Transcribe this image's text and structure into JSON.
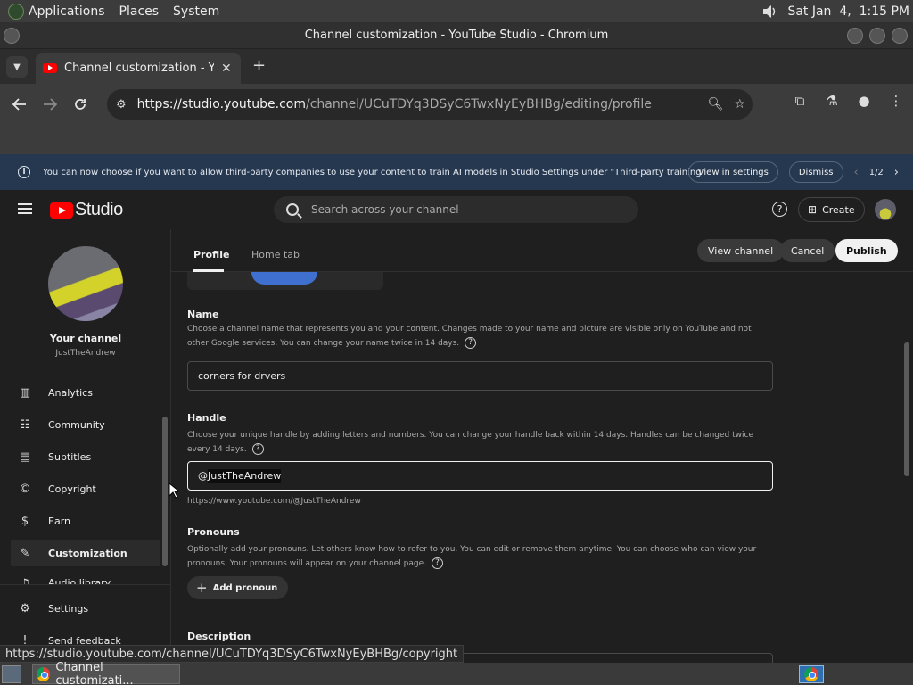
{
  "system_panel": {
    "menus": [
      "Applications",
      "Places",
      "System"
    ],
    "clock": "Sat Jan  4,  1:15 PM"
  },
  "window": {
    "title": "Channel customization - YouTube Studio - Chromium"
  },
  "browser": {
    "tab": {
      "title": "Channel customization - YouTube Studio",
      "close": "✕"
    },
    "new_tab": "+",
    "url_host": "https://studio.youtube.com",
    "url_path": "/channel/UCuTDYq3DSyC6TwxNyEyBHBg/editing/profile"
  },
  "banner": {
    "text": "You can now choose if you want to allow third-party companies to use your content to train AI models in Studio Settings under \"Third-party training\"",
    "view_settings": "View in settings",
    "dismiss": "Dismiss",
    "pager": "1/2"
  },
  "studio": {
    "logo_text": "Studio",
    "search_placeholder": "Search across your channel",
    "create_label": "Create"
  },
  "sidebar": {
    "channel_title": "Your channel",
    "channel_handle": "JustTheAndrew",
    "items": [
      {
        "label": "Analytics",
        "icon": "analytics-icon"
      },
      {
        "label": "Community",
        "icon": "community-icon"
      },
      {
        "label": "Subtitles",
        "icon": "subtitles-icon"
      },
      {
        "label": "Copyright",
        "icon": "copyright-icon"
      },
      {
        "label": "Earn",
        "icon": "earn-icon"
      },
      {
        "label": "Customization",
        "icon": "customization-icon"
      },
      {
        "label": "Audio library",
        "icon": "audio-library-icon"
      },
      {
        "label": "Settings",
        "icon": "settings-icon"
      },
      {
        "label": "Send feedback",
        "icon": "feedback-icon"
      }
    ]
  },
  "main": {
    "tabs": [
      "Profile",
      "Home tab"
    ],
    "view_channel": "View channel",
    "cancel": "Cancel",
    "publish": "Publish",
    "name_section": {
      "title": "Name",
      "desc": "Choose a channel name that represents you and your content. Changes made to your name and picture are visible only on YouTube and not other Google services. You can change your name twice in 14 days.",
      "value": "corners for drvers"
    },
    "handle_section": {
      "title": "Handle",
      "desc": "Choose your unique handle by adding letters and numbers. You can change your handle back within 14 days. Handles can be changed twice every 14 days.",
      "prefix": "@",
      "value": "JustTheAndrew",
      "url": "https://www.youtube.com/@JustTheAndrew"
    },
    "pronouns_section": {
      "title": "Pronouns",
      "desc": "Optionally add your pronouns. Let others know how to refer to you. You can edit or remove them anytime. You can choose who can view your pronouns. Your pronouns will appear on your channel page.",
      "add_label": "Add pronoun"
    },
    "description_section": {
      "title": "Description"
    }
  },
  "status_bar": {
    "url": "https://studio.youtube.com/channel/UCuTDYq3DSyC6TwxNyEyBHBg/copyright"
  },
  "taskbar": {
    "item": "Channel customizati..."
  }
}
